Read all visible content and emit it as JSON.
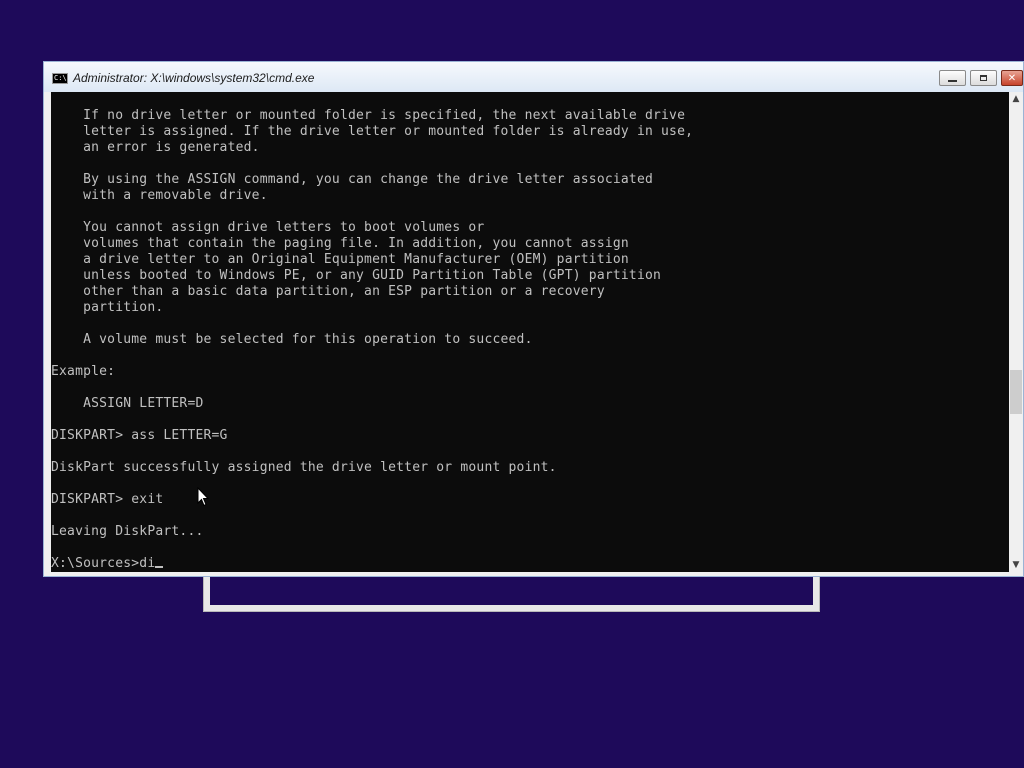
{
  "window": {
    "title": "Administrator: X:\\windows\\system32\\cmd.exe",
    "icon_label": "C:\\"
  },
  "controls": {
    "minimize_icon": "minimize-icon",
    "maximize_icon": "maximize-icon",
    "close_icon": "close-icon",
    "close_glyph": "✕"
  },
  "scrollbar": {
    "up_glyph": "▲",
    "down_glyph": "▼"
  },
  "console": {
    "lines": [
      "    If no drive letter or mounted folder is specified, the next available drive",
      "    letter is assigned. If the drive letter or mounted folder is already in use,",
      "    an error is generated.",
      "",
      "    By using the ASSIGN command, you can change the drive letter associated",
      "    with a removable drive.",
      "",
      "    You cannot assign drive letters to boot volumes or",
      "    volumes that contain the paging file. In addition, you cannot assign",
      "    a drive letter to an Original Equipment Manufacturer (OEM) partition",
      "    unless booted to Windows PE, or any GUID Partition Table (GPT) partition",
      "    other than a basic data partition, an ESP partition or a recovery",
      "    partition.",
      "",
      "    A volume must be selected for this operation to succeed.",
      "",
      "Example:",
      "",
      "    ASSIGN LETTER=D",
      "",
      "DISKPART> ass LETTER=G",
      "",
      "DiskPart successfully assigned the drive letter or mount point.",
      "",
      "DISKPART> exit",
      "",
      "Leaving DiskPart...",
      ""
    ],
    "prompt_line": "X:\\Sources>di"
  },
  "colors": {
    "desktop": "#1e0a5a",
    "console_bg": "#0c0c0c",
    "console_text": "#c0c0c0"
  }
}
